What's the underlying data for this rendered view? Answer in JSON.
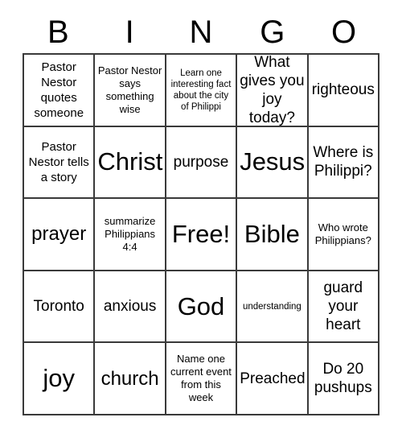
{
  "card": {
    "title_letters": [
      "B",
      "I",
      "N",
      "G",
      "O"
    ],
    "colors": {
      "background": "#ffffff",
      "cell_background": "#ffffff",
      "grid_line": "#3a3a3a",
      "text": "#000000"
    },
    "grid": {
      "columns": 5,
      "rows": 5,
      "free_space": "Free!"
    },
    "cells": [
      {
        "text": "Pastor Nestor quotes someone",
        "size": "sm",
        "column": "B",
        "row": 1
      },
      {
        "text": "Pastor Nestor says something wise",
        "size": "xs",
        "column": "I",
        "row": 1
      },
      {
        "text": "Learn one interesting fact about the city of Philippi",
        "size": "xxs",
        "column": "N",
        "row": 1
      },
      {
        "text": "What gives you joy today?",
        "size": "md",
        "column": "G",
        "row": 1
      },
      {
        "text": "righteous",
        "size": "md",
        "column": "O",
        "row": 1
      },
      {
        "text": "Pastor Nestor tells a story",
        "size": "sm",
        "column": "B",
        "row": 2
      },
      {
        "text": "Christ",
        "size": "xl",
        "column": "I",
        "row": 2
      },
      {
        "text": "purpose",
        "size": "md",
        "column": "N",
        "row": 2
      },
      {
        "text": "Jesus",
        "size": "xl",
        "column": "G",
        "row": 2
      },
      {
        "text": "Where is Philippi?",
        "size": "md",
        "column": "O",
        "row": 2
      },
      {
        "text": "prayer",
        "size": "lg",
        "column": "B",
        "row": 3
      },
      {
        "text": "summarize Philippians 4:4",
        "size": "xs",
        "column": "I",
        "row": 3
      },
      {
        "text": "Free!",
        "size": "xl",
        "column": "N",
        "row": 3
      },
      {
        "text": "Bible",
        "size": "xl",
        "column": "G",
        "row": 3
      },
      {
        "text": "Who wrote Philippians?",
        "size": "xs",
        "column": "O",
        "row": 3
      },
      {
        "text": "Toronto",
        "size": "md",
        "column": "B",
        "row": 4
      },
      {
        "text": "anxious",
        "size": "md",
        "column": "I",
        "row": 4
      },
      {
        "text": "God",
        "size": "xl",
        "column": "N",
        "row": 4
      },
      {
        "text": "understanding",
        "size": "xxs",
        "column": "G",
        "row": 4
      },
      {
        "text": "guard your heart",
        "size": "md",
        "column": "O",
        "row": 4
      },
      {
        "text": "joy",
        "size": "xl",
        "column": "B",
        "row": 5
      },
      {
        "text": "church",
        "size": "lg",
        "column": "I",
        "row": 5
      },
      {
        "text": "Name one current event from this week",
        "size": "xs",
        "column": "N",
        "row": 5
      },
      {
        "text": "Preached",
        "size": "md",
        "column": "G",
        "row": 5
      },
      {
        "text": "Do 20 pushups",
        "size": "md",
        "column": "O",
        "row": 5
      }
    ]
  }
}
